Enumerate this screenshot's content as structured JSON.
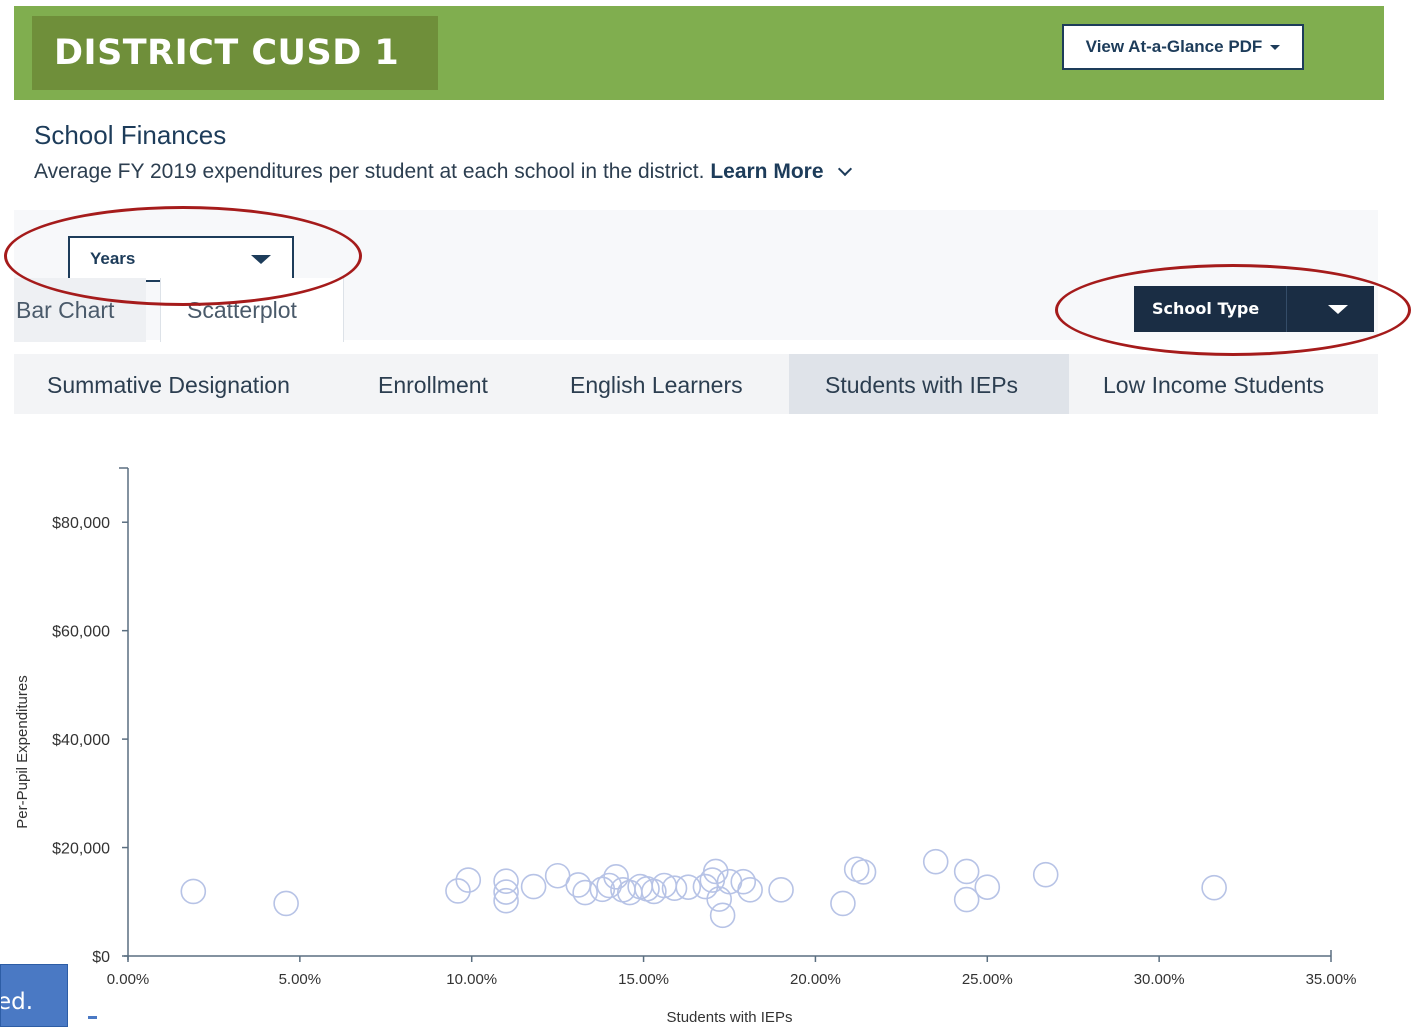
{
  "header": {
    "district_title": "DISTRICT CUSD 1",
    "pdf_button_label": "View At-a-Glance PDF"
  },
  "section": {
    "title": "School Finances",
    "description": "Average FY 2019 expenditures per student at each school in the district.",
    "learn_more_label": "Learn More"
  },
  "filters": {
    "years_label": "Years",
    "school_type_label": "School Type"
  },
  "view_tabs": [
    {
      "label": "Bar Chart"
    },
    {
      "label": "Scatterplot",
      "selected": true
    }
  ],
  "metric_tabs": [
    {
      "label": "Summative Designation"
    },
    {
      "label": "Enrollment"
    },
    {
      "label": "English Learners"
    },
    {
      "label": "Students with IEPs",
      "selected": true
    },
    {
      "label": "Low Income Students"
    }
  ],
  "annotations": {
    "highlight_color": "#a51b1b",
    "note_text": "ed."
  },
  "chart_data": {
    "type": "scatter",
    "title": "",
    "xlabel": "Students with IEPs",
    "ylabel": "Per-Pupil Expenditures",
    "xlim": [
      0,
      35
    ],
    "ylim": [
      0,
      90000
    ],
    "x_ticks": [
      "0.00%",
      "5.00%",
      "10.00%",
      "15.00%",
      "20.00%",
      "25.00%",
      "30.00%",
      "35.00%"
    ],
    "y_ticks": [
      "$0",
      "$20,000",
      "$40,000",
      "$60,000",
      "$80,000"
    ],
    "grid": false,
    "marker_color": "#b7c3e6",
    "series": [
      {
        "points": [
          [
            1.9,
            11900
          ],
          [
            4.6,
            9700
          ],
          [
            9.6,
            12000
          ],
          [
            9.9,
            14000
          ],
          [
            11.0,
            13800
          ],
          [
            11.0,
            11800
          ],
          [
            11.0,
            10200
          ],
          [
            11.8,
            12800
          ],
          [
            12.5,
            14800
          ],
          [
            13.1,
            13100
          ],
          [
            13.3,
            11700
          ],
          [
            13.8,
            12300
          ],
          [
            14.0,
            13000
          ],
          [
            14.2,
            14600
          ],
          [
            14.4,
            12200
          ],
          [
            14.6,
            11700
          ],
          [
            14.9,
            12800
          ],
          [
            15.1,
            12400
          ],
          [
            15.3,
            11900
          ],
          [
            15.6,
            13000
          ],
          [
            15.9,
            12500
          ],
          [
            16.3,
            12700
          ],
          [
            16.8,
            12800
          ],
          [
            17.0,
            14000
          ],
          [
            17.1,
            15600
          ],
          [
            17.2,
            10500
          ],
          [
            17.3,
            7500
          ],
          [
            17.5,
            13700
          ],
          [
            17.9,
            13700
          ],
          [
            18.1,
            12200
          ],
          [
            19.0,
            12200
          ],
          [
            20.8,
            9700
          ],
          [
            21.2,
            16000
          ],
          [
            21.4,
            15500
          ],
          [
            23.5,
            17400
          ],
          [
            24.4,
            15600
          ],
          [
            24.4,
            10400
          ],
          [
            25.0,
            12700
          ],
          [
            26.7,
            15000
          ],
          [
            31.6,
            12600
          ]
        ]
      }
    ]
  }
}
